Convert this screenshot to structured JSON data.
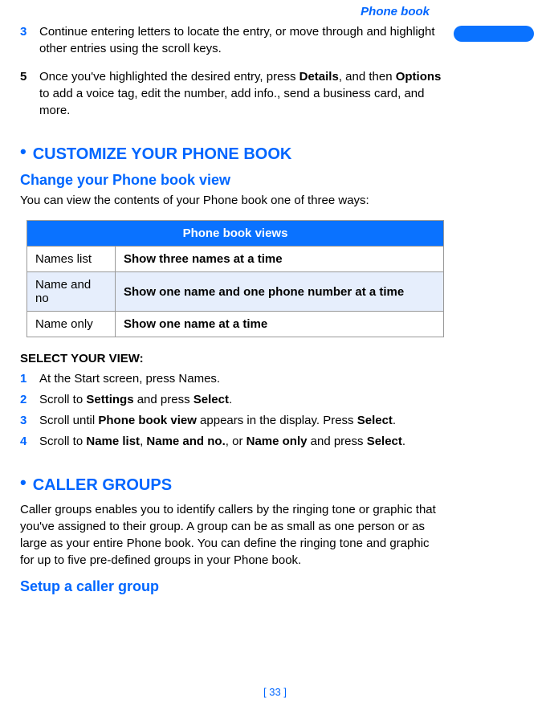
{
  "header": {
    "title": "Phone book"
  },
  "steps_top": [
    {
      "num": "3",
      "num_color": "blue",
      "text": "Continue entering letters to locate the entry, or move through and highlight other entries using the scroll keys."
    },
    {
      "num": "5",
      "num_color": "black",
      "html": "Once you've highlighted the desired entry, press <b>Details</b>, and then <b>Options</b> to add a voice tag, edit the number, add info., send a business card, and more."
    }
  ],
  "section1": {
    "title": "CUSTOMIZE YOUR PHONE BOOK",
    "sub": "Change your Phone book view",
    "intro": "You can view the contents of your Phone book one of three ways:"
  },
  "table": {
    "header": "Phone book views",
    "rows": [
      {
        "label": "Names list",
        "desc": "Show three names at a time",
        "shaded": false
      },
      {
        "label": "Name and no",
        "desc": "Show one name and one phone number at a time",
        "shaded": true
      },
      {
        "label": "Name only",
        "desc": "Show one name at a time",
        "shaded": false
      }
    ]
  },
  "select_view": {
    "title": "SELECT YOUR VIEW:",
    "steps": [
      {
        "num": "1",
        "html": "At the Start screen, press Names."
      },
      {
        "num": "2",
        "html": "Scroll to <b>Settings</b> and press <b>Select</b>."
      },
      {
        "num": "3",
        "html": "Scroll until <b>Phone book view</b> appears in the display. Press <b>Select</b>."
      },
      {
        "num": "4",
        "html": "Scroll to <b>Name list</b>, <b>Name and no.</b>, or <b>Name only</b> and press <b>Select</b>."
      }
    ]
  },
  "section2": {
    "title": "CALLER GROUPS",
    "para": "Caller groups enables you to identify callers by the ringing tone or graphic that you've assigned to their group. A group can be as small as one person or as large as your entire Phone book. You can define the ringing tone and graphic for up to five pre-defined groups in your Phone book.",
    "sub": "Setup a caller group"
  },
  "footer": "[ 33 ]"
}
